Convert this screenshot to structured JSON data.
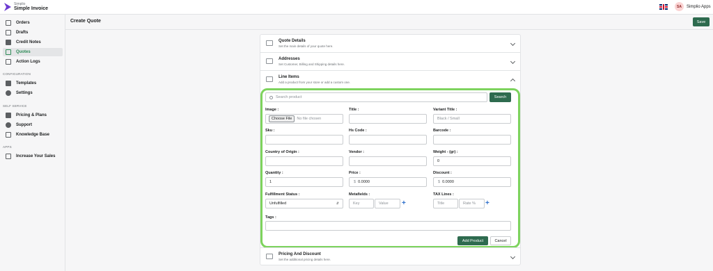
{
  "app": {
    "brand_small": "Simplio",
    "brand_name": "Simple Invoice"
  },
  "header": {
    "avatar_initials": "SA",
    "account_name": "Simplio Apps"
  },
  "sidebar": {
    "items": [
      {
        "label": "Orders",
        "icon": "orders-icon"
      },
      {
        "label": "Drafts",
        "icon": "drafts-icon"
      },
      {
        "label": "Credit Notes",
        "icon": "credit-notes-icon"
      },
      {
        "label": "Quotes",
        "icon": "quotes-icon",
        "active": true
      },
      {
        "label": "Action Logs",
        "icon": "action-logs-icon"
      }
    ],
    "config_label": "CONFIGURATION",
    "config_items": [
      {
        "label": "Templates",
        "icon": "templates-icon"
      },
      {
        "label": "Settings",
        "icon": "gear-icon"
      }
    ],
    "self_service_label": "SELF SERVICE",
    "self_service_items": [
      {
        "label": "Pricing & Plans",
        "icon": "pricing-icon"
      },
      {
        "label": "Support",
        "icon": "support-icon"
      },
      {
        "label": "Knowledge Base",
        "icon": "book-icon"
      }
    ],
    "apps_label": "APPS",
    "apps_items": [
      {
        "label": "Increase Your Sales",
        "icon": "sales-icon"
      }
    ]
  },
  "page": {
    "title": "Create Quote",
    "save_label": "Save"
  },
  "sections": {
    "quote_details": {
      "title": "Quote Details",
      "subtitle": "Set the main details of your quote here."
    },
    "addresses": {
      "title": "Addresses",
      "subtitle": "Set Customer, Billing and Shipping details here."
    },
    "line_items": {
      "title": "Line Items",
      "subtitle": "Add a product from your store or add a custom one."
    },
    "pricing": {
      "title": "Pricing And Discount",
      "subtitle": "Set the additional pricing details here."
    }
  },
  "line_item_form": {
    "search_placeholder": "Search product",
    "search_button": "Search",
    "image_label": "Image :",
    "choose_file": "Choose File",
    "no_file": "No file chosen",
    "title_label": "Title :",
    "variant_title_label": "Variant Title :",
    "variant_placeholder": "Black / Small",
    "sku_label": "Sku :",
    "hs_code_label": "Hs Code :",
    "barcode_label": "Barcode :",
    "country_label": "Country of Origin :",
    "vendor_label": "Vendor :",
    "weight_label": "Weight - (gr) :",
    "weight_value": "0",
    "quantity_label": "Quantity :",
    "quantity_value": "1",
    "price_label": "Price :",
    "currency_symbol": "$",
    "price_value": "0.0000",
    "discount_label": "Discount :",
    "discount_value": "0.0000",
    "fulfillment_label": "Fulfillment Status :",
    "fulfillment_value": "Unfulfilled",
    "metafields_label": "Metafields :",
    "key_placeholder": "Key",
    "value_placeholder": "Value",
    "tax_lines_label": "TAX Lines :",
    "tax_title_placeholder": "Title",
    "tax_rate_placeholder": "Rate %",
    "tags_label": "Tags :",
    "add_product": "Add Product",
    "cancel": "Cancel"
  },
  "colors": {
    "primary": "#2e6b4f",
    "active_nav": "#2e8b57",
    "highlight": "#7dd35d",
    "link": "#2c6ecb"
  }
}
